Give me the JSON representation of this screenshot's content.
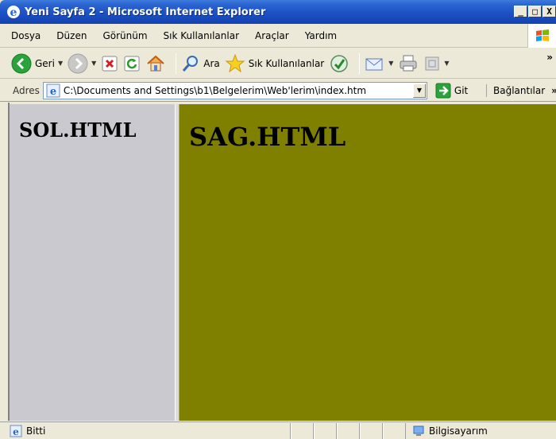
{
  "window": {
    "title": "Yeni Sayfa 2 - Microsoft Internet Explorer",
    "buttons": [
      "_",
      "□",
      "X"
    ]
  },
  "menu": [
    "Dosya",
    "Düzen",
    "Görünüm",
    "Sık Kullanılanlar",
    "Araçlar",
    "Yardım"
  ],
  "toolbar": {
    "back_label": "Geri",
    "search_label": "Ara",
    "favorites_label": "Sık Kullanılanlar",
    "more": "»"
  },
  "address": {
    "label": "Adres",
    "value": "C:\\Documents and Settings\\b1\\Belgelerim\\Web'lerim\\index.htm",
    "go_label": "Git",
    "links_label": "Bağlantılar",
    "more": "»"
  },
  "frames": {
    "left": {
      "heading": "SOL.HTML",
      "bg": "#c9c9cf"
    },
    "right": {
      "heading": "SAG.HTML",
      "bg": "#808000"
    }
  },
  "status": {
    "text": "Bitti",
    "zone": "Bilgisayarım"
  },
  "colors": {
    "titlebar": "#1a4fc2",
    "chrome": "#ece9d8"
  }
}
